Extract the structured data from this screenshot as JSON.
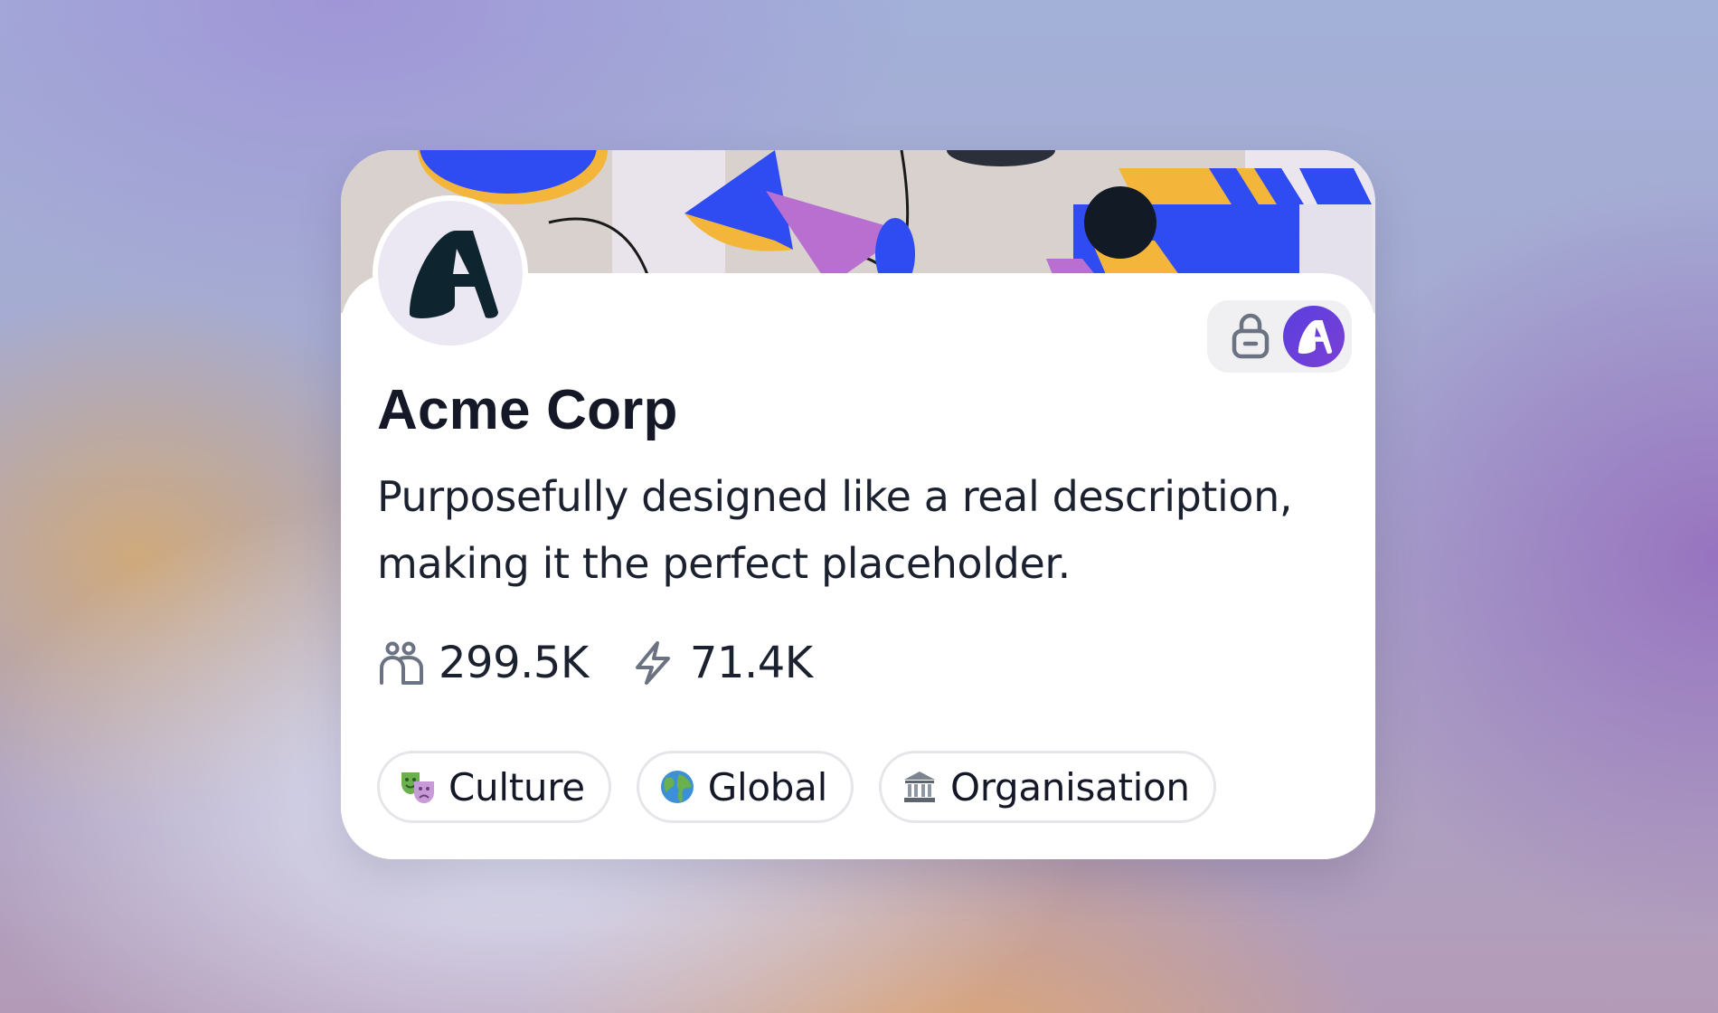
{
  "card": {
    "name": "Acme Corp",
    "description": "Purposefully designed like a real description, making it the perfect placeholder.",
    "avatar_icon": "acme-logo-icon",
    "badges": [
      {
        "icon": "lock-icon"
      },
      {
        "icon": "acme-mini-logo-icon"
      }
    ],
    "stats": [
      {
        "icon": "members-icon",
        "value": "299.5K"
      },
      {
        "icon": "lightning-icon",
        "value": "71.4K"
      }
    ],
    "tags": [
      {
        "icon": "theater-masks-icon",
        "label": "Culture"
      },
      {
        "icon": "globe-icon",
        "label": "Global"
      },
      {
        "icon": "classical-building-icon",
        "label": "Organisation"
      }
    ]
  },
  "colors": {
    "brand_purple": "#5a3fe0",
    "banner_blue": "#2f4bf2",
    "banner_yellow": "#f4b63a",
    "banner_pink": "#b86fd0",
    "text_dark": "#141827",
    "icon_gray": "#6b7382"
  }
}
